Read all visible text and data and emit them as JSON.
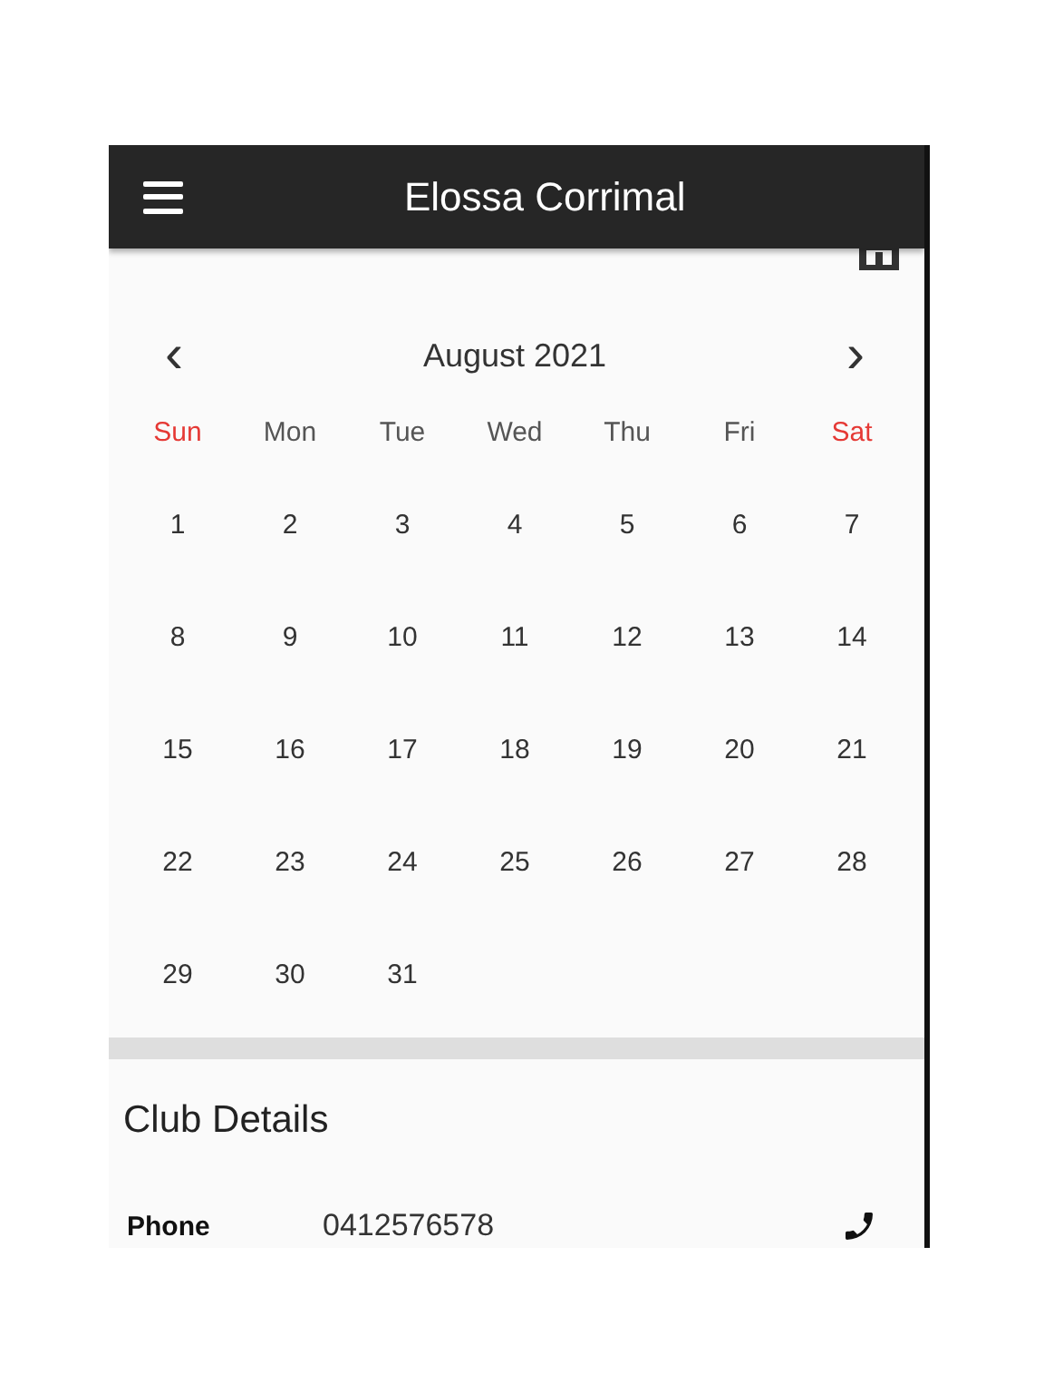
{
  "app_bar": {
    "title": "Elossa Corrimal"
  },
  "visit_history": {
    "calendar": {
      "month": "August 2021",
      "prev": "‹",
      "next": "›",
      "weekdays": [
        {
          "label": "Sun",
          "weekend": true
        },
        {
          "label": "Mon",
          "weekend": false
        },
        {
          "label": "Tue",
          "weekend": false
        },
        {
          "label": "Wed",
          "weekend": false
        },
        {
          "label": "Thu",
          "weekend": false
        },
        {
          "label": "Fri",
          "weekend": false
        },
        {
          "label": "Sat",
          "weekend": true
        }
      ],
      "weeks": [
        [
          "1",
          "2",
          "3",
          "4",
          "5",
          "6",
          "7"
        ],
        [
          "8",
          "9",
          "10",
          "11",
          "12",
          "13",
          "14"
        ],
        [
          "15",
          "16",
          "17",
          "18",
          "19",
          "20",
          "21"
        ],
        [
          "22",
          "23",
          "24",
          "25",
          "26",
          "27",
          "28"
        ],
        [
          "29",
          "30",
          "31"
        ]
      ]
    }
  },
  "club_details": {
    "title": "Club Details",
    "rows": [
      {
        "label": "Phone",
        "value": "0412576578"
      }
    ]
  }
}
